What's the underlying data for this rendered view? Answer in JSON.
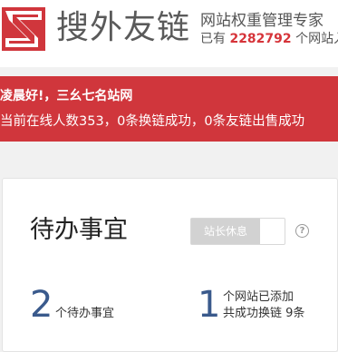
{
  "header": {
    "brand": "搜外友链",
    "tagline": "网站权重管理专家",
    "count_prefix": "已有",
    "count_value": "2282792",
    "count_suffix": "个网站入"
  },
  "banner": {
    "greeting": "凌晨好!，三幺七名站网",
    "online_text": "当前在线人数353，0条换链成功，0条友链出售成功"
  },
  "card": {
    "title": "待办事宜",
    "toggle_label": "站长休息",
    "help_glyph": "?",
    "todo_count": "2",
    "todo_label": "个待办事宜",
    "sites_count": "1",
    "sites_label_line1": "个网站已添加",
    "sites_label_line2": "共成功换链 9条"
  },
  "colors": {
    "brand_red": "#d0363c",
    "number_blue": "#3a5a8c"
  }
}
